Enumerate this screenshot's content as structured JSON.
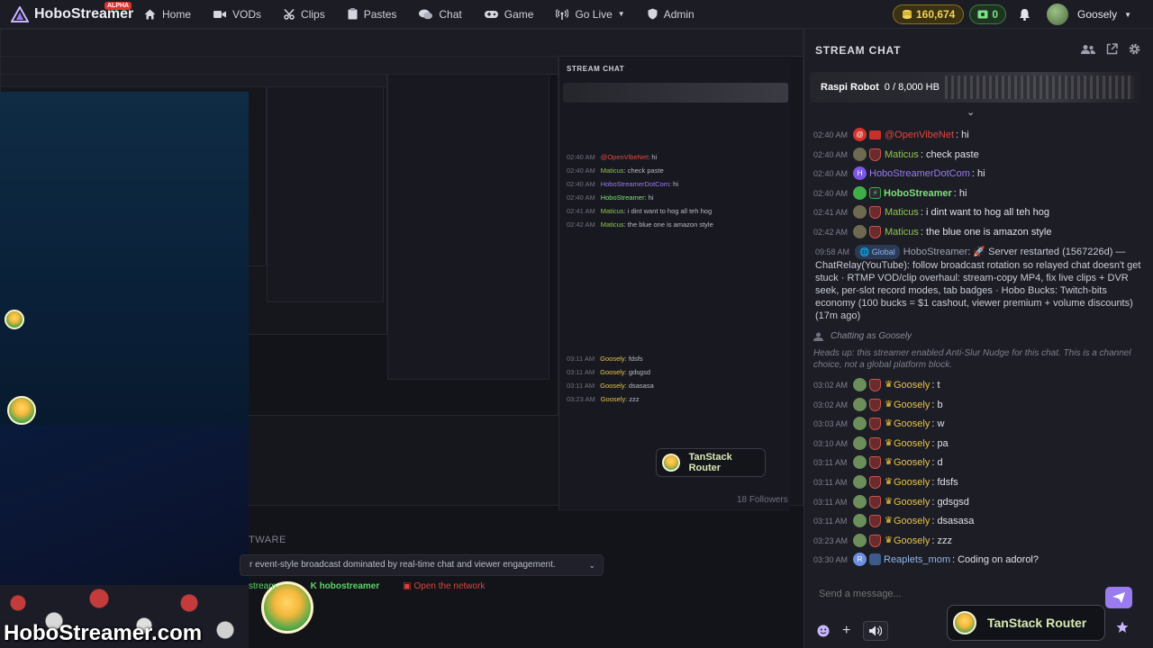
{
  "nav": {
    "brand": "HoboStreamer",
    "alpha_badge": "ALPHA",
    "links": [
      {
        "label": "Home",
        "icon": "home-icon"
      },
      {
        "label": "VODs",
        "icon": "video-icon"
      },
      {
        "label": "Clips",
        "icon": "scissors-icon"
      },
      {
        "label": "Pastes",
        "icon": "paste-icon"
      },
      {
        "label": "Chat",
        "icon": "chat-icon"
      },
      {
        "label": "Game",
        "icon": "gamepad-icon"
      },
      {
        "label": "Go Live",
        "icon": "broadcast-icon"
      },
      {
        "label": "Admin",
        "icon": "shield-icon"
      }
    ],
    "coins": "160,674",
    "cash": "0",
    "username": "Goosely"
  },
  "stream": {
    "watermark": "HoboStreamer.com",
    "software_label": "TWARE",
    "description": "r event-style broadcast dominated by real-time chat and viewer engagement.",
    "tag_green": "hobostreamer",
    "tag_left": "stream",
    "tag_red": "Open the network",
    "followers": "18 Followers",
    "tanstack_label": "TanStack Router"
  },
  "chat": {
    "title": "STREAM CHAT",
    "robot_name": "Raspi Robot",
    "robot_storage": "0 / 8,000 HB",
    "messages": [
      {
        "time": "02:40 AM",
        "user": "@OpenVibeNet",
        "text": ": hi",
        "color": "u-red",
        "badge_color": "#d9342b",
        "badge_glyph": "@",
        "shield": false,
        "red_box": true
      },
      {
        "time": "02:40 AM",
        "user": "Maticus",
        "text": ": check paste",
        "color": "u-green",
        "badge_color": "#6e6a52",
        "badge_glyph": "",
        "shield": true
      },
      {
        "time": "02:40 AM",
        "user": "HoboStreamerDotCom",
        "text": ": hi",
        "color": "u-purple",
        "badge_color": "#7c56e6",
        "badge_glyph": "H",
        "shield": false
      },
      {
        "time": "02:40 AM",
        "user": "HoboStreamer",
        "text": ": hi",
        "color": "u-lime",
        "badge_color": "#3fae4a",
        "badge_glyph": "⚡",
        "shield": false,
        "lime_badge": true
      },
      {
        "time": "02:41 AM",
        "user": "Maticus",
        "text": ": i dint want to hog all teh hog",
        "color": "u-green",
        "badge_color": "#6e6a52",
        "badge_glyph": "",
        "shield": true
      },
      {
        "time": "02:42 AM",
        "user": "Maticus",
        "text": ": the blue one is amazon style",
        "color": "u-green",
        "badge_color": "#6e6a52",
        "badge_glyph": "",
        "shield": true
      }
    ],
    "system": {
      "time": "09:58 AM",
      "tag": "Global",
      "user": "HoboStreamer",
      "text": ": 🚀 Server restarted (1567226d) — ChatRelay(YouTube): follow broadcast rotation so relayed chat doesn't get stuck · RTMP VOD/clip overhaul: stream-copy MP4, fix live clips + DVR seek, per-slot record modes, tab badges · Hobo Bucks: Twitch-bits economy (100 bucks = $1 cashout, viewer premium + volume discounts) (17m ago)"
    },
    "chatting_as": "Chatting as Goosely",
    "nudge": "Heads up: this streamer enabled Anti-Slur Nudge for this chat. This is a channel choice, not a global platform block.",
    "goosely_messages": [
      {
        "time": "03:02 AM",
        "user": "Goosely",
        "text": ": t"
      },
      {
        "time": "03:02 AM",
        "user": "Goosely",
        "text": ": b"
      },
      {
        "time": "03:03 AM",
        "user": "Goosely",
        "text": ": w"
      },
      {
        "time": "03:10 AM",
        "user": "Goosely",
        "text": ": pa"
      },
      {
        "time": "03:11 AM",
        "user": "Goosely",
        "text": ": d"
      },
      {
        "time": "03:11 AM",
        "user": "Goosely",
        "text": ": fdsfs"
      },
      {
        "time": "03:11 AM",
        "user": "Goosely",
        "text": ": gdsgsd"
      },
      {
        "time": "03:11 AM",
        "user": "Goosely",
        "text": ": dsasasa"
      },
      {
        "time": "03:23 AM",
        "user": "Goosely",
        "text": ": zzz"
      }
    ],
    "last_message": {
      "time": "03:30 AM",
      "user": "Reaplets_mom",
      "text": ": Coding on adorol?"
    },
    "composer_placeholder": "Send a message...",
    "tanstack_label": "TanStack Router"
  },
  "colors": {
    "accent": "#9b7cf0",
    "coin_gold": "#f2d45a",
    "cash_green": "#7ee08a"
  }
}
